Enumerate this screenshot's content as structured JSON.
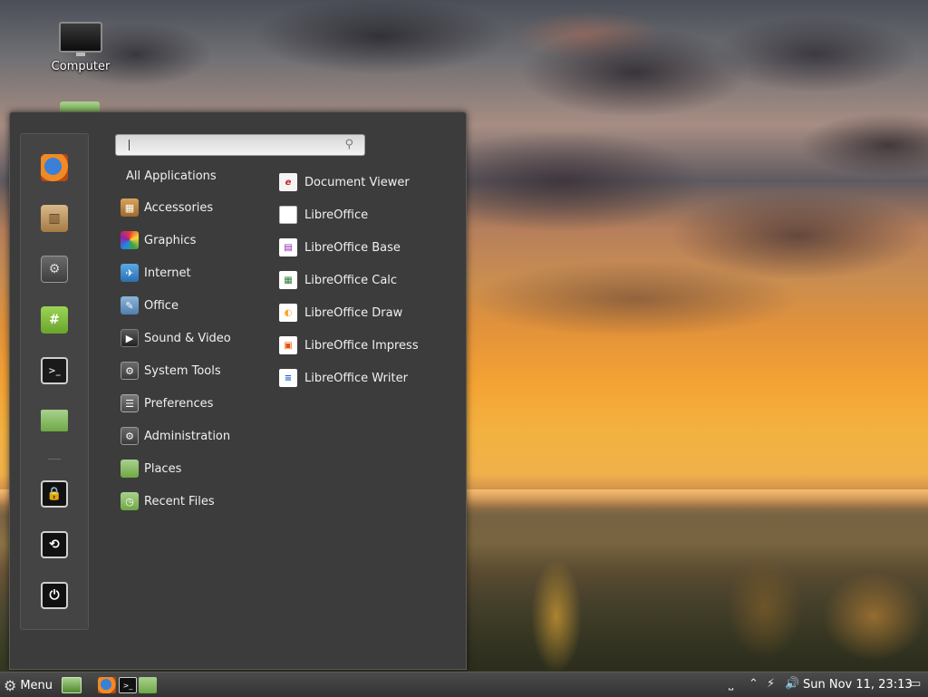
{
  "desktop": {
    "icons": [
      {
        "label": "Computer",
        "icon": "computer-icon"
      }
    ]
  },
  "menu": {
    "search": {
      "placeholder": "",
      "value": ""
    },
    "favorites": [
      {
        "icon": "firefox-icon"
      },
      {
        "icon": "software-manager-icon"
      },
      {
        "icon": "system-settings-icon"
      },
      {
        "icon": "hexchat-icon"
      },
      {
        "icon": "terminal-icon"
      },
      {
        "icon": "files-folder-icon"
      },
      {
        "icon": "lock-screen-icon"
      },
      {
        "icon": "logout-icon"
      },
      {
        "icon": "shutdown-icon"
      }
    ],
    "categories_header": "All Applications",
    "categories": [
      {
        "label": "Accessories",
        "icon": "accessories-icon"
      },
      {
        "label": "Graphics",
        "icon": "graphics-icon"
      },
      {
        "label": "Internet",
        "icon": "internet-icon"
      },
      {
        "label": "Office",
        "icon": "office-icon"
      },
      {
        "label": "Sound & Video",
        "icon": "sound-video-icon"
      },
      {
        "label": "System Tools",
        "icon": "system-tools-icon"
      },
      {
        "label": "Preferences",
        "icon": "preferences-icon"
      },
      {
        "label": "Administration",
        "icon": "administration-icon"
      },
      {
        "label": "Places",
        "icon": "places-folder-icon"
      },
      {
        "label": "Recent Files",
        "icon": "recent-files-icon"
      }
    ],
    "apps": [
      {
        "label": "Document Viewer",
        "icon": "document-viewer-icon"
      },
      {
        "label": "LibreOffice",
        "icon": "libreoffice-icon"
      },
      {
        "label": "LibreOffice Base",
        "icon": "libreoffice-base-icon"
      },
      {
        "label": "LibreOffice Calc",
        "icon": "libreoffice-calc-icon"
      },
      {
        "label": "LibreOffice Draw",
        "icon": "libreoffice-draw-icon"
      },
      {
        "label": "LibreOffice Impress",
        "icon": "libreoffice-impress-icon"
      },
      {
        "label": "LibreOffice Writer",
        "icon": "libreoffice-writer-icon"
      }
    ]
  },
  "taskbar": {
    "menu_label": "Menu",
    "clock": "Sun Nov 11, 23:13",
    "launchers": [
      "show-desktop-icon",
      "firefox-icon",
      "terminal-icon",
      "files-folder-icon"
    ],
    "tray": [
      "keyboard-icon",
      "chevron-up-icon",
      "network-icon",
      "volume-icon",
      "display-icon"
    ]
  },
  "colors": {
    "menu_bg": "#3c3c3c",
    "favorites_bg": "#444444",
    "taskbar_bg": "#3b3b3b",
    "accent_green": "#8bc34a"
  }
}
